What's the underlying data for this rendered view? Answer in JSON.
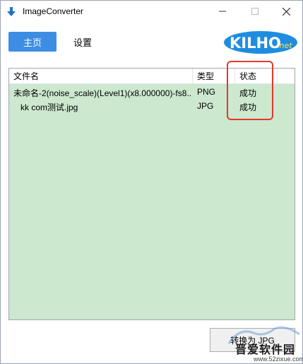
{
  "window": {
    "title": "ImageConverter"
  },
  "nav": {
    "home_label": "主页",
    "settings_label": "设置"
  },
  "logo": {
    "text_main": "KILHO",
    "text_suffix": ".net"
  },
  "table": {
    "columns": [
      "文件名",
      "类型",
      "状态"
    ],
    "rows": [
      {
        "name": "未命名-2(noise_scale)(Level1)(x8.000000)-fs8....",
        "type": "PNG",
        "status": "成功"
      },
      {
        "name": "kk com测试.jpg",
        "type": "JPG",
        "status": "成功"
      }
    ]
  },
  "actions": {
    "convert_label": "转换为 JPG"
  },
  "watermark": {
    "title": "晋爱软件园",
    "url": "www.52zixue.com"
  },
  "colors": {
    "accent": "#3d8ee3",
    "list_bg": "#cce8cf",
    "highlight": "#e03a2a"
  },
  "icons": {
    "app": "app-down-arrow-icon",
    "minimize": "minimize-icon",
    "maximize": "maximize-icon",
    "close": "close-icon"
  }
}
